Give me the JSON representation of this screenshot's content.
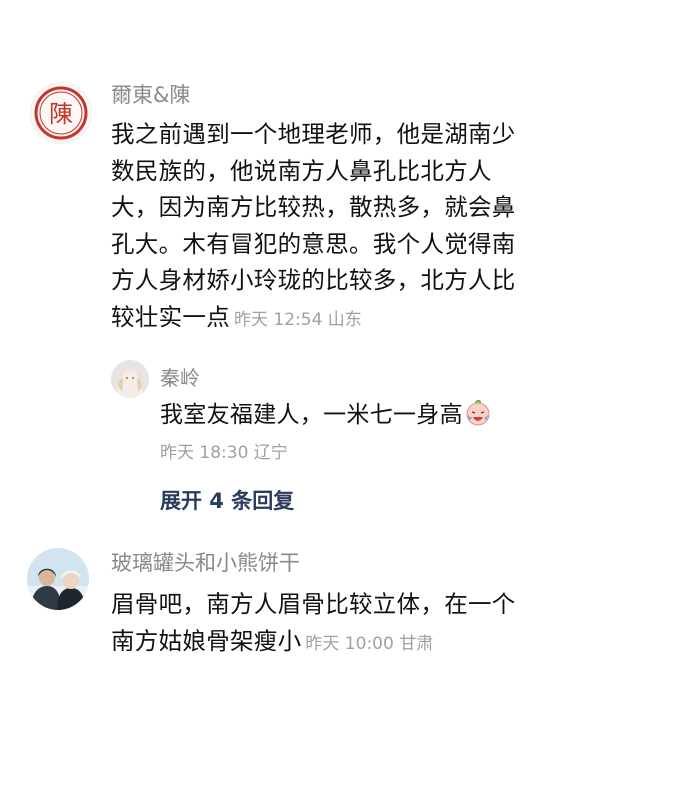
{
  "colors": {
    "username": "#8a8a8a",
    "body_text": "#111111",
    "meta": "#a0a0a0",
    "expand_link": "#2a3c5c",
    "seal_red": "#c4342a"
  },
  "comments": [
    {
      "username": "爾東&陳",
      "avatar_icon": "red-seal-chen-avatar",
      "avatar_text": "陳",
      "lines": [
        "我之前遇到一个地理老师，他是湖南少",
        "数民族的，他说南方人鼻孔比北方人",
        "大，因为南方比较热，散热多，就会鼻",
        "孔大。木有冒犯的意思。我个人觉得南",
        "方人身材娇小玲珑的比较多，北方人比",
        "较壮实一点"
      ],
      "meta": "昨天 12:54 山东",
      "reply": {
        "username": "秦岭",
        "avatar_icon": "anime-girl-avatar",
        "text": "我室友福建人，一米七一身高",
        "emoji": "crying-laughing-emoji",
        "meta": "昨天 18:30 辽宁"
      },
      "expand_label": "展开 4 条回复"
    },
    {
      "username": "玻璃罐头和小熊饼干",
      "avatar_icon": "couple-photo-avatar",
      "lines": [
        "眉骨吧，南方人眉骨比较立体，在一个",
        "南方姑娘骨架瘦小"
      ],
      "meta": "昨天 10:00 甘肃"
    }
  ]
}
